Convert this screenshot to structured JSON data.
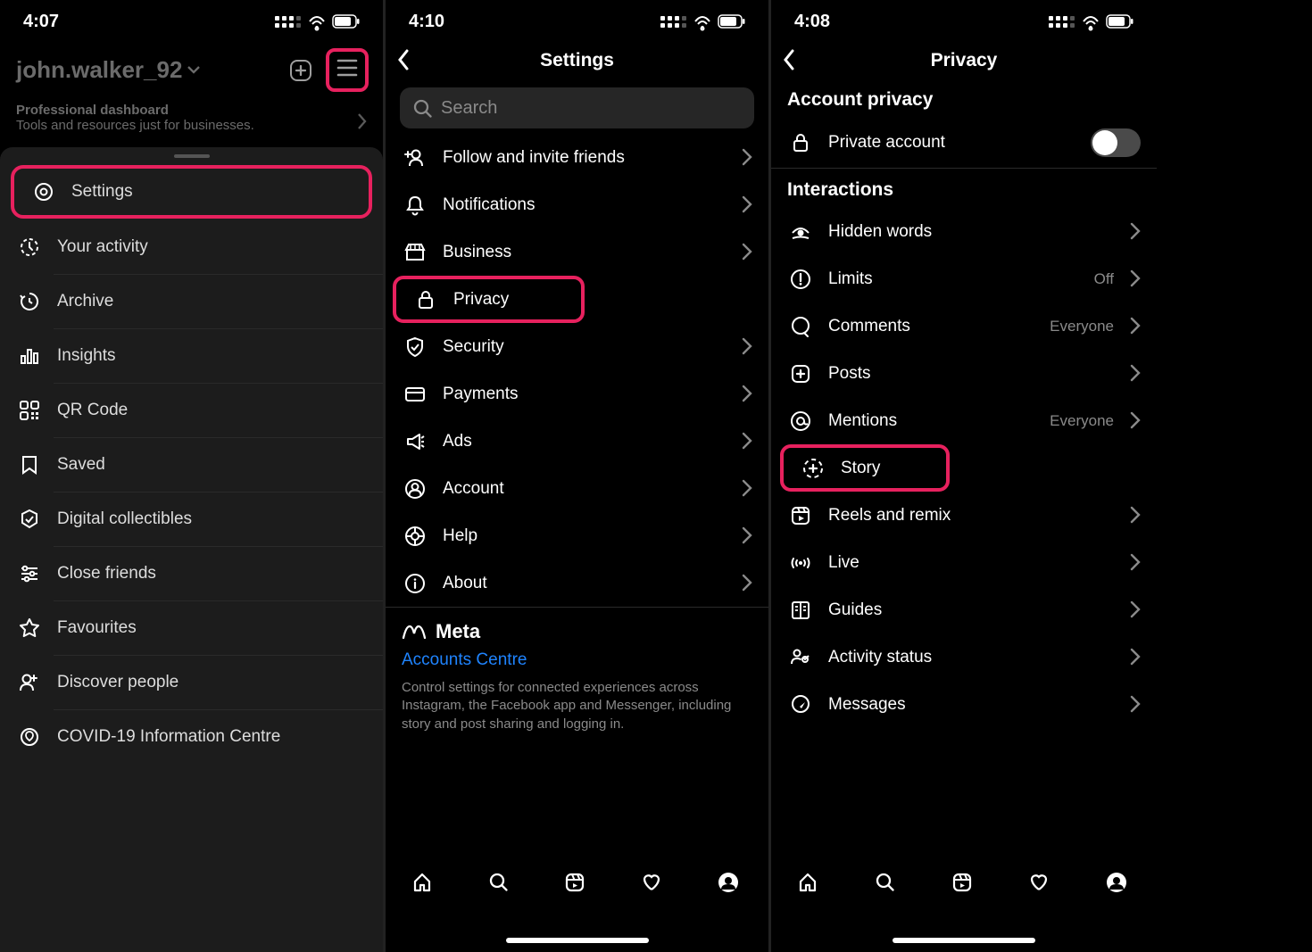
{
  "highlight_color": "#e7215e",
  "panel1": {
    "time": "4:07",
    "username": "john.walker_92",
    "dash_title": "Professional dashboard",
    "dash_sub": "Tools and resources just for businesses.",
    "menu": [
      {
        "icon": "settings",
        "label": "Settings",
        "hl": true
      },
      {
        "icon": "activity",
        "label": "Your activity"
      },
      {
        "icon": "archive",
        "label": "Archive"
      },
      {
        "icon": "insights",
        "label": "Insights"
      },
      {
        "icon": "qr",
        "label": "QR Code"
      },
      {
        "icon": "saved",
        "label": "Saved"
      },
      {
        "icon": "collect",
        "label": "Digital collectibles"
      },
      {
        "icon": "close",
        "label": "Close friends"
      },
      {
        "icon": "star",
        "label": "Favourites"
      },
      {
        "icon": "discover",
        "label": "Discover people"
      },
      {
        "icon": "covid",
        "label": "COVID-19 Information Centre"
      }
    ]
  },
  "panel2": {
    "time": "4:10",
    "title": "Settings",
    "search_ph": "Search",
    "items": [
      {
        "icon": "follow",
        "label": "Follow and invite friends"
      },
      {
        "icon": "bell",
        "label": "Notifications"
      },
      {
        "icon": "shop",
        "label": "Business"
      },
      {
        "icon": "lock",
        "label": "Privacy",
        "hl": true
      },
      {
        "icon": "shield",
        "label": "Security"
      },
      {
        "icon": "card",
        "label": "Payments"
      },
      {
        "icon": "ads",
        "label": "Ads"
      },
      {
        "icon": "account",
        "label": "Account"
      },
      {
        "icon": "help",
        "label": "Help"
      },
      {
        "icon": "info",
        "label": "About"
      }
    ],
    "meta_brand": "Meta",
    "accounts_centre": "Accounts Centre",
    "meta_desc": "Control settings for connected experiences across Instagram, the Facebook app and Messenger, including story and post sharing and logging in."
  },
  "panel3": {
    "time": "4:08",
    "title": "Privacy",
    "section1": "Account privacy",
    "private_label": "Private account",
    "section2": "Interactions",
    "items": [
      {
        "icon": "hidden",
        "label": "Hidden words"
      },
      {
        "icon": "limits",
        "label": "Limits",
        "val": "Off"
      },
      {
        "icon": "comments",
        "label": "Comments",
        "val": "Everyone"
      },
      {
        "icon": "posts",
        "label": "Posts"
      },
      {
        "icon": "mentions",
        "label": "Mentions",
        "val": "Everyone"
      },
      {
        "icon": "story",
        "label": "Story",
        "hl": true
      },
      {
        "icon": "reels",
        "label": "Reels and remix"
      },
      {
        "icon": "live",
        "label": "Live"
      },
      {
        "icon": "guides",
        "label": "Guides"
      },
      {
        "icon": "activity2",
        "label": "Activity status"
      },
      {
        "icon": "messages",
        "label": "Messages"
      }
    ]
  }
}
